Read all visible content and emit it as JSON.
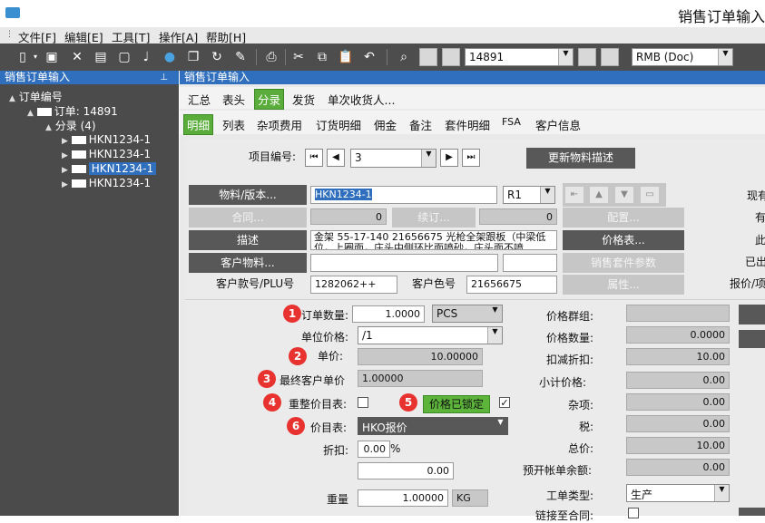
{
  "window": {
    "title": "销售订单输入"
  },
  "menu": [
    "文件[F]",
    "编辑[E]",
    "工具[T]",
    "操作[A]",
    "帮助[H]"
  ],
  "toolbar": {
    "record_value": "14891",
    "currency_value": "RMB (Doc)"
  },
  "left_pane": {
    "header": "销售订单输入",
    "tree": {
      "root": "订单编号",
      "order": "订单: 14891",
      "group": "分录 (4)",
      "items": [
        "HKN1234-1",
        "HKN1234-1",
        "HKN1234-1",
        "HKN1234-1"
      ],
      "selected_index": 2
    }
  },
  "right_pane": {
    "header": "销售订单输入",
    "tabs_top": [
      "汇总",
      "表头",
      "分录",
      "发货",
      "单次收货人..."
    ],
    "tabs_top_active": 2,
    "tabs_sub": [
      "明细",
      "列表",
      "杂项费用",
      "订货明细",
      "佣金",
      "备注",
      "套件明细",
      "FSA",
      "客户信息"
    ],
    "tabs_sub_active": 0
  },
  "form": {
    "item_no_label": "项目编号:",
    "item_no_value": "3",
    "update_desc_button": "更新物料描述",
    "material_button": "物料/版本...",
    "material_value": "HKN1234-1",
    "revision_value": "R1",
    "contract_button": "合同...",
    "contract_value": "0",
    "order_btn": "续订...",
    "order_value": "0",
    "config_button": "配置...",
    "description_button": "描述",
    "description_value": "金架 55-17-140 21656675 光枪全架跟板（中梁低位，上圈面，庄头中侧环比面喷砂，庄头面不喷",
    "price_list_button": "价格表...",
    "customer_item_button": "客户物料...",
    "kit_param_button": "销售套件参数",
    "attribute_button": "属性...",
    "cust_plu_label": "客户款号/PLU号",
    "cust_plu_value": "1282062++",
    "cust_color_label": "客户色号",
    "cust_color_value": "21656675",
    "side_labels": [
      "现有",
      "有",
      "此",
      "已出",
      "报价/项"
    ]
  },
  "pricing": {
    "qty_label": "订单数量:",
    "qty_value": "1.0000",
    "uom_value": "PCS",
    "unit_price_label": "单位价格:",
    "unit_price_value": "/1",
    "price_label": "单价:",
    "price_value": "10.00000",
    "final_price_label": "最终客户单价",
    "final_price_value": "1.00000",
    "rebalance_label": "重整价目表:",
    "locked_button": "价格已锁定",
    "locked_checked": true,
    "price_list_label": "价目表:",
    "price_list_value": "HKO报价",
    "discount_label": "折扣:",
    "discount_value": "0.00",
    "discount_unit": "%",
    "discount_amount": "0.00",
    "weight_label": "重量",
    "weight_value": "1.00000",
    "weight_unit": "KG",
    "badges": [
      "1",
      "2",
      "3",
      "4",
      "5",
      "6"
    ]
  },
  "summary": {
    "labels": [
      "价格群组:",
      "价格数量:",
      "扣减折扣:",
      "小计价格:",
      "杂项:",
      "税:",
      "总价:",
      "预开帐单余额:"
    ],
    "values": [
      "",
      "0.0000",
      "10.00",
      "0.00",
      "0.00",
      "0.00",
      "10.00",
      "0.00"
    ],
    "order_type_label": "工单类型:",
    "order_type_value": "生产",
    "link_label": "链接至合同:"
  }
}
